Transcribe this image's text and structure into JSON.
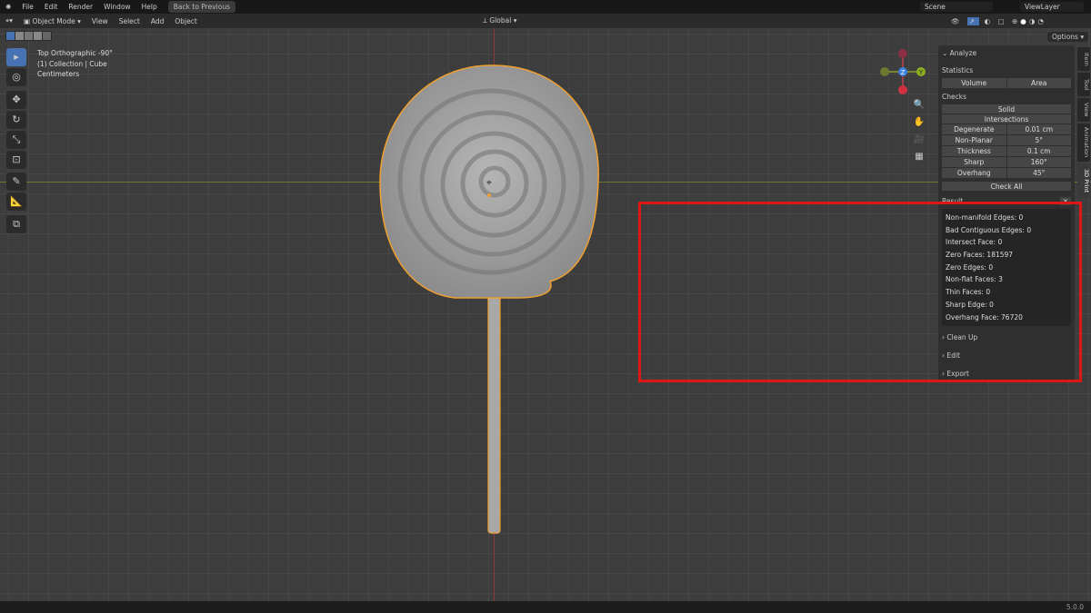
{
  "topbar": {
    "menus": [
      "File",
      "Edit",
      "Render",
      "Window",
      "Help"
    ],
    "back_button": "Back to Previous",
    "scene": "Scene",
    "view_layer": "ViewLayer"
  },
  "header": {
    "mode": "Object Mode",
    "menus": [
      "View",
      "Select",
      "Add",
      "Object"
    ],
    "transform": "Global",
    "options": "Options"
  },
  "viewport": {
    "view_name": "Top Orthographic -90°",
    "collection": "(1) Collection | Cube",
    "units": "Centimeters",
    "gizmo": {
      "z": "Z",
      "y": "Y"
    }
  },
  "panel": {
    "analyze": "Analyze",
    "statistics": "Statistics",
    "volume": "Volume",
    "area": "Area",
    "checks": "Checks",
    "solid": "Solid",
    "intersections": "Intersections",
    "params": [
      {
        "label": "Degenerate",
        "value": "0.01 cm"
      },
      {
        "label": "Non-Planar",
        "value": "5°"
      },
      {
        "label": "Thickness",
        "value": "0.1 cm"
      },
      {
        "label": "Sharp",
        "value": "160°"
      },
      {
        "label": "Overhang",
        "value": "45°"
      }
    ],
    "check_all": "Check All",
    "result": "Result",
    "results": [
      "Non-manifold Edges: 0",
      "Bad Contiguous Edges: 0",
      "Intersect Face: 0",
      "Zero Faces: 181597",
      "Zero Edges: 0",
      "Non-flat Faces: 3",
      "Thin Faces: 0",
      "Sharp Edge: 0",
      "Overhang Face: 76720"
    ],
    "clean_up": "Clean Up",
    "edit": "Edit",
    "export": "Export"
  },
  "tabs": [
    "Item",
    "Tool",
    "View",
    "Animation",
    "3D Print"
  ],
  "status": {
    "version": "5.0.0"
  },
  "colors": {
    "highlight": "#e01515",
    "selection": "#f0a030",
    "accent": "#4772b3"
  }
}
